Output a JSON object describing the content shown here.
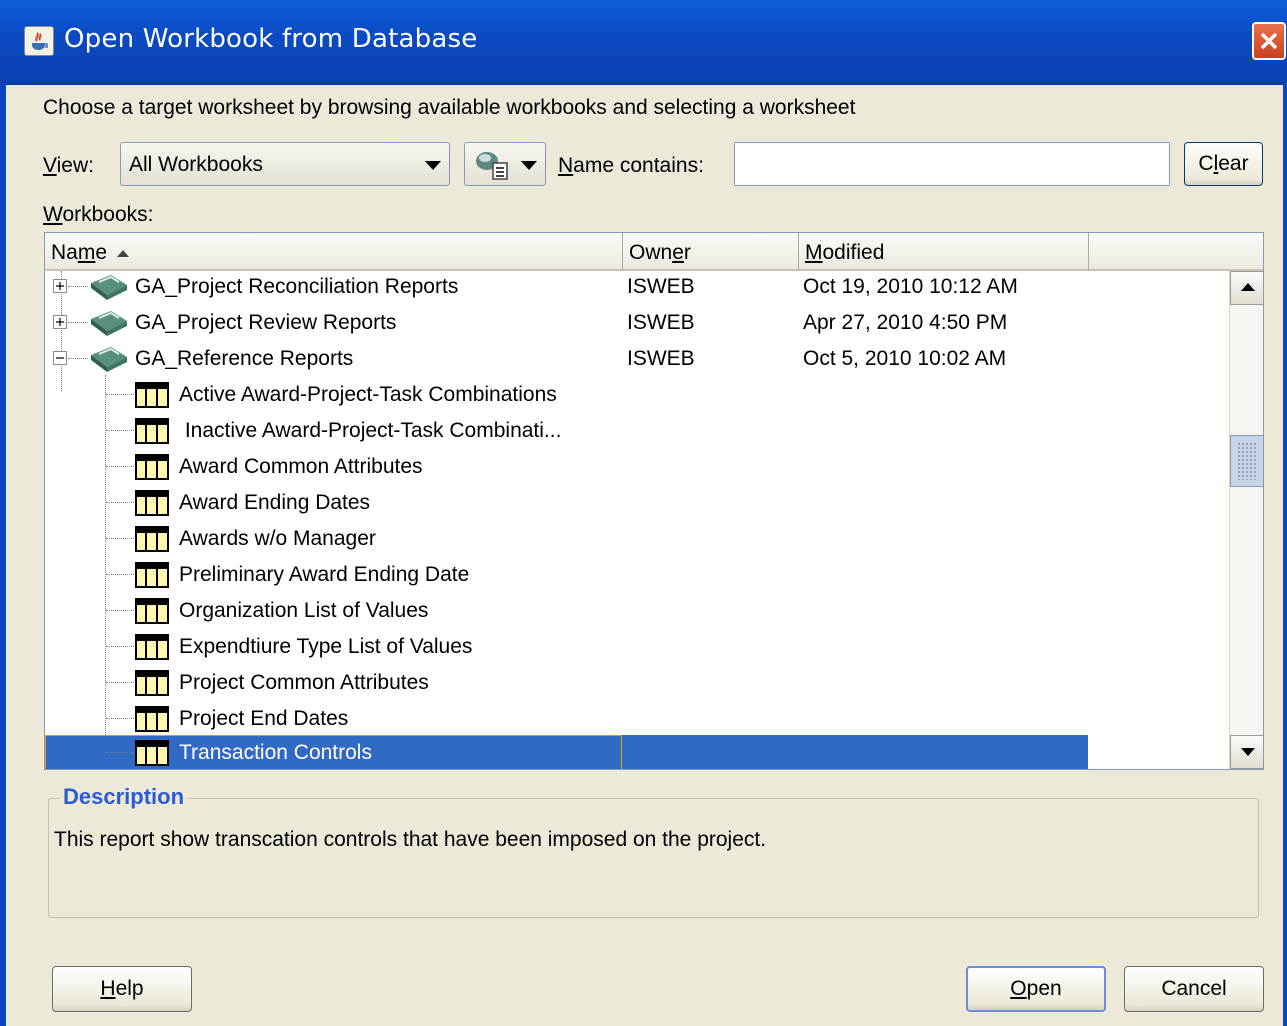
{
  "window": {
    "title": "Open Workbook from Database"
  },
  "instruction": "Choose a target worksheet by browsing available workbooks and selecting a worksheet",
  "view": {
    "label_first": "V",
    "label_rest": "iew:",
    "selected": "All Workbooks"
  },
  "filter": {
    "label_first": "N",
    "label_rest": "ame contains:",
    "value": "",
    "clear_pre": "C",
    "clear_u": "l",
    "clear_post": "ear"
  },
  "workbooks_label": {
    "first": "W",
    "rest": "orkbooks:"
  },
  "table": {
    "columns": {
      "name_pre": "Na",
      "name_u": "m",
      "name_post": "e",
      "owner_pre": "Own",
      "owner_u": "e",
      "owner_post": "r",
      "modified_first": "M",
      "modified_rest": "odified"
    },
    "workbooks": [
      {
        "name": "GA_Project Reconciliation Reports",
        "owner": "ISWEB",
        "modified": "Oct 19, 2010 10:12 AM",
        "expanded": false
      },
      {
        "name": "GA_Project Review Reports",
        "owner": "ISWEB",
        "modified": "Apr 27, 2010 4:50 PM",
        "expanded": false
      },
      {
        "name": "GA_Reference Reports",
        "owner": "ISWEB",
        "modified": "Oct 5, 2010 10:02 AM",
        "expanded": true
      }
    ],
    "worksheets": [
      "Active Award-Project-Task Combinations",
      " Inactive Award-Project-Task Combinati...",
      "Award Common Attributes",
      "Award Ending Dates",
      "Awards w/o Manager",
      "Preliminary Award Ending Date",
      "Organization List of Values",
      "Expendtiure Type List of Values",
      "Project Common Attributes",
      "Project End Dates",
      "Transaction Controls"
    ],
    "selected_worksheet": "Transaction Controls"
  },
  "description": {
    "legend": "Description",
    "text": "This report show transcation controls that have been imposed on the project."
  },
  "buttons": {
    "help_first": "H",
    "help_rest": "elp",
    "open_first": "O",
    "open_rest": "pen",
    "cancel": "Cancel"
  },
  "colors": {
    "title_bar": "#0b4bc4",
    "selection": "#316ac5",
    "legend_text": "#2c5bd8",
    "dialog_bg": "#ece9d8"
  }
}
